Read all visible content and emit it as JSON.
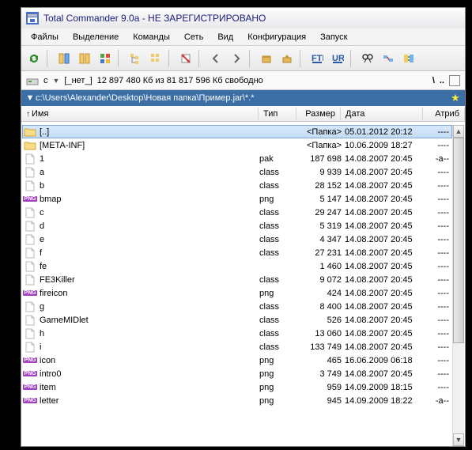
{
  "title": "Total Commander 9.0a - НЕ ЗАРЕГИСТРИРОВАНО",
  "menu": [
    "Файлы",
    "Выделение",
    "Команды",
    "Сеть",
    "Вид",
    "Конфигурация",
    "Запуск"
  ],
  "drive": {
    "letter": "c",
    "none": "[_нет_]",
    "space": "12 897 480 Кб из 81 817 596 Кб свободно"
  },
  "path": "c:\\Users\\Alexander\\Desktop\\Новая папка\\Пример.jar\\*.*",
  "cols": {
    "name": "Имя",
    "ext": "Тип",
    "size": "Размер",
    "date": "Дата",
    "attr": "Атриб"
  },
  "rows": [
    {
      "ic": "folder",
      "nm": "[..]",
      "ex": "",
      "sz": "<Папка>",
      "dt": "05.01.2012 20:12",
      "at": "----",
      "sel": true
    },
    {
      "ic": "folder",
      "nm": "[META-INF]",
      "ex": "",
      "sz": "<Папка>",
      "dt": "10.06.2009 18:27",
      "at": "----"
    },
    {
      "ic": "file",
      "nm": "1",
      "ex": "pak",
      "sz": "187 698",
      "dt": "14.08.2007 20:45",
      "at": "-a--"
    },
    {
      "ic": "file",
      "nm": "a",
      "ex": "class",
      "sz": "9 939",
      "dt": "14.08.2007 20:45",
      "at": "----"
    },
    {
      "ic": "file",
      "nm": "b",
      "ex": "class",
      "sz": "28 152",
      "dt": "14.08.2007 20:45",
      "at": "----"
    },
    {
      "ic": "png",
      "nm": "bmap",
      "ex": "png",
      "sz": "5 147",
      "dt": "14.08.2007 20:45",
      "at": "----"
    },
    {
      "ic": "file",
      "nm": "c",
      "ex": "class",
      "sz": "29 247",
      "dt": "14.08.2007 20:45",
      "at": "----"
    },
    {
      "ic": "file",
      "nm": "d",
      "ex": "class",
      "sz": "5 319",
      "dt": "14.08.2007 20:45",
      "at": "----"
    },
    {
      "ic": "file",
      "nm": "e",
      "ex": "class",
      "sz": "4 347",
      "dt": "14.08.2007 20:45",
      "at": "----"
    },
    {
      "ic": "file",
      "nm": "f",
      "ex": "class",
      "sz": "27 231",
      "dt": "14.08.2007 20:45",
      "at": "----"
    },
    {
      "ic": "file",
      "nm": "fe",
      "ex": "",
      "sz": "1 460",
      "dt": "14.08.2007 20:45",
      "at": "----"
    },
    {
      "ic": "file",
      "nm": "FE3Killer",
      "ex": "class",
      "sz": "9 072",
      "dt": "14.08.2007 20:45",
      "at": "----"
    },
    {
      "ic": "png",
      "nm": "fireicon",
      "ex": "png",
      "sz": "424",
      "dt": "14.08.2007 20:45",
      "at": "----"
    },
    {
      "ic": "file",
      "nm": "g",
      "ex": "class",
      "sz": "8 400",
      "dt": "14.08.2007 20:45",
      "at": "----"
    },
    {
      "ic": "file",
      "nm": "GameMIDlet",
      "ex": "class",
      "sz": "526",
      "dt": "14.08.2007 20:45",
      "at": "----"
    },
    {
      "ic": "file",
      "nm": "h",
      "ex": "class",
      "sz": "13 060",
      "dt": "14.08.2007 20:45",
      "at": "----"
    },
    {
      "ic": "file",
      "nm": "i",
      "ex": "class",
      "sz": "133 749",
      "dt": "14.08.2007 20:45",
      "at": "----"
    },
    {
      "ic": "png",
      "nm": "icon",
      "ex": "png",
      "sz": "465",
      "dt": "16.06.2009 06:18",
      "at": "----"
    },
    {
      "ic": "png",
      "nm": "intro0",
      "ex": "png",
      "sz": "3 749",
      "dt": "14.08.2007 20:45",
      "at": "----"
    },
    {
      "ic": "png",
      "nm": "item",
      "ex": "png",
      "sz": "959",
      "dt": "14.09.2009 18:15",
      "at": "----"
    },
    {
      "ic": "png",
      "nm": "letter",
      "ex": "png",
      "sz": "945",
      "dt": "14.09.2009 18:22",
      "at": "-a--"
    }
  ]
}
